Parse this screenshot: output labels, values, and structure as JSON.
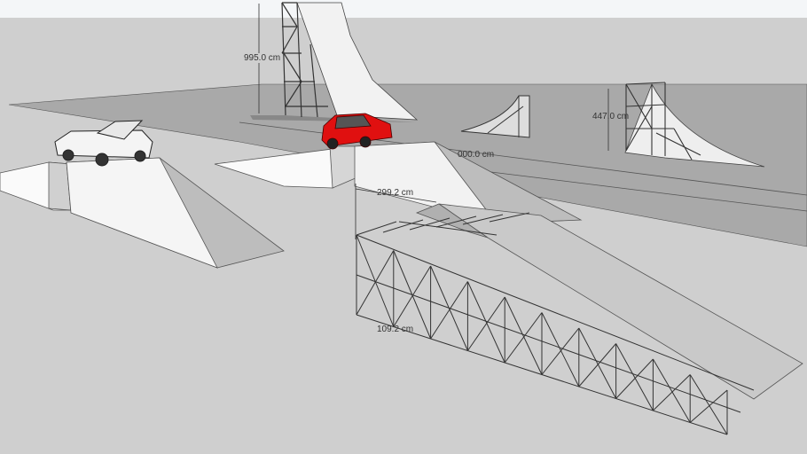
{
  "scene": {
    "sky_color": "#f4f6f8",
    "ground_color": "#cfcfcf",
    "surface_color": "#a9a9a9",
    "car_color": "#e01010"
  },
  "dimensions": {
    "tower_height": "995.0 cm",
    "ramp_height": "447.0 cm",
    "track_length": "000.0 cm",
    "gap_length": "299.2 cm",
    "ramp_base": "109.2 cm"
  }
}
